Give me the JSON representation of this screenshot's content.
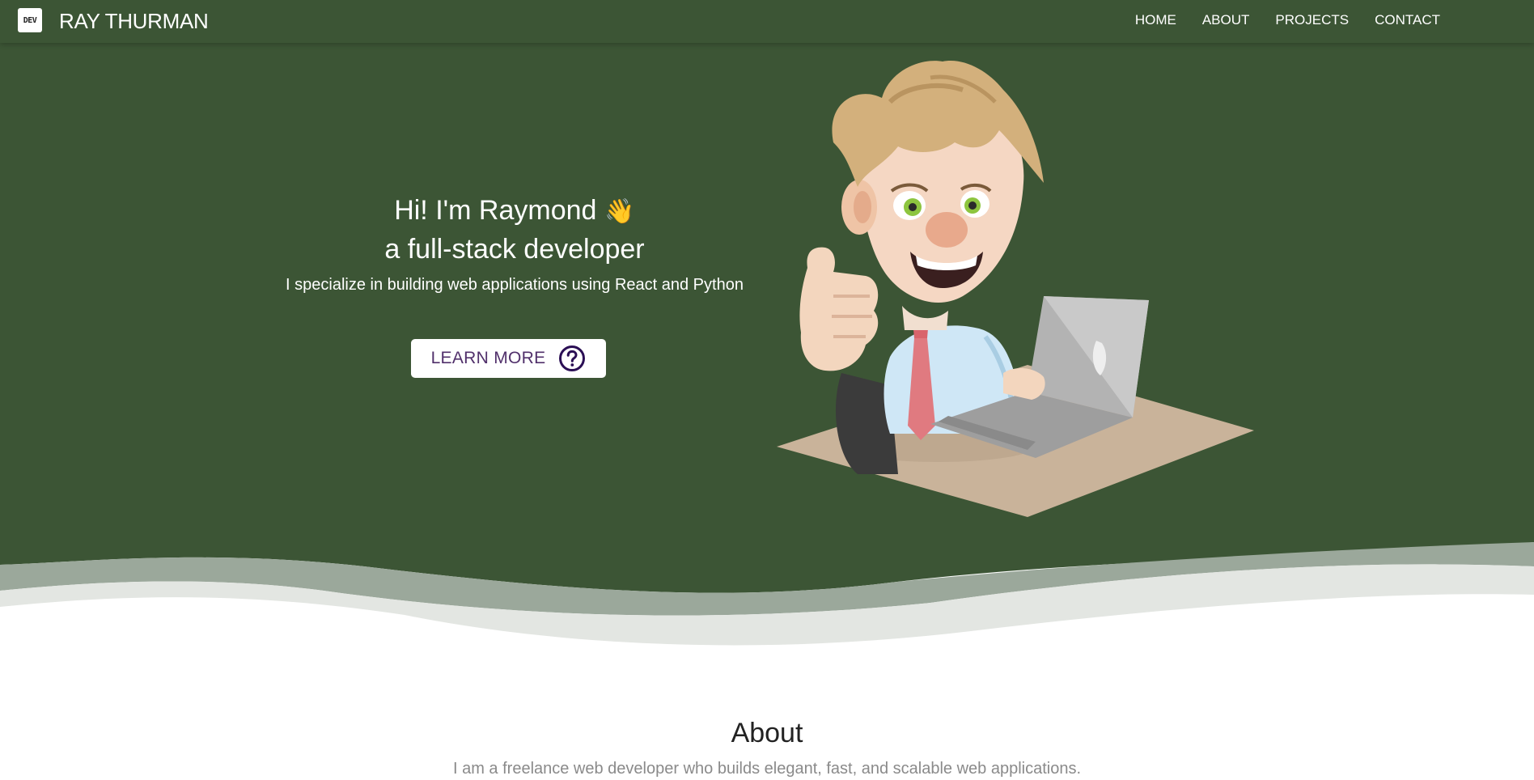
{
  "nav": {
    "logo_text": "DEV",
    "brand": "RAY THURMAN",
    "links": [
      {
        "label": "HOME"
      },
      {
        "label": "ABOUT"
      },
      {
        "label": "PROJECTS"
      },
      {
        "label": "CONTACT"
      }
    ]
  },
  "hero": {
    "greeting": "Hi! I'm Raymond",
    "greeting_emoji": "👋",
    "role": "a full-stack developer",
    "subtitle": "I specialize in building web applications using React and Python",
    "button": {
      "label": "LEARN MORE",
      "icon": "question-circle-icon"
    },
    "illustration": "cartoon-developer-with-laptop"
  },
  "about": {
    "title": "About",
    "text": "I am a freelance web developer who builds elegant, fast, and scalable web applications."
  },
  "colors": {
    "hero_bg": "#3c5535",
    "nav_bg": "#3c5535",
    "button_text": "#51306b",
    "text_light": "#ffffff",
    "about_text": "#8a8a8a"
  }
}
